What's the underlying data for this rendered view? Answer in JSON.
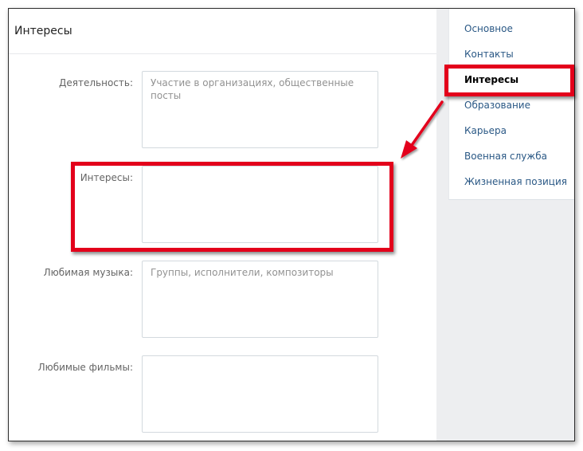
{
  "page": {
    "title": "Интересы"
  },
  "fields": [
    {
      "label": "Деятельность:",
      "placeholder": "Участие в организациях, общественные посты",
      "value": ""
    },
    {
      "label": "Интересы:",
      "placeholder": "",
      "value": ""
    },
    {
      "label": "Любимая музыка:",
      "placeholder": "Группы, исполнители, композиторы",
      "value": ""
    },
    {
      "label": "Любимые фильмы:",
      "placeholder": "",
      "value": ""
    }
  ],
  "sidebar": {
    "items": [
      {
        "label": "Основное",
        "active": false
      },
      {
        "label": "Контакты",
        "active": false
      },
      {
        "label": "Интересы",
        "active": true
      },
      {
        "label": "Образование",
        "active": false
      },
      {
        "label": "Карьера",
        "active": false
      },
      {
        "label": "Военная служба",
        "active": false
      },
      {
        "label": "Жизненная позиция",
        "active": false
      }
    ]
  },
  "colors": {
    "highlight": "#e3001b",
    "link": "#2a5885",
    "label": "#656565"
  }
}
